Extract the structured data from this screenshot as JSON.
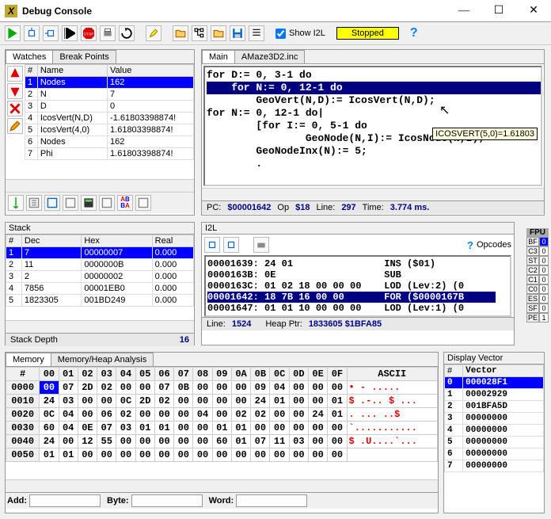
{
  "window": {
    "title": "Debug Console"
  },
  "toolbar": {
    "showI2L": "Show I2L",
    "status": "Stopped"
  },
  "watches": {
    "tabs": [
      "Watches",
      "Break Points"
    ],
    "headers": [
      "#",
      "Name",
      "Value"
    ],
    "rows": [
      {
        "n": "1",
        "name": "Nodes",
        "val": "162"
      },
      {
        "n": "2",
        "name": "N",
        "val": "7"
      },
      {
        "n": "3",
        "name": "D",
        "val": "0"
      },
      {
        "n": "4",
        "name": "IcosVert(N,D)",
        "val": "-1.61803398874!"
      },
      {
        "n": "5",
        "name": "IcosVert(4,0)",
        "val": "1.61803398874!"
      },
      {
        "n": "6",
        "name": "Nodes",
        "val": "162"
      },
      {
        "n": "7",
        "name": "Phi",
        "val": "1.61803398874!"
      }
    ]
  },
  "source": {
    "tabs": [
      "Main",
      "AMaze3D2.inc"
    ],
    "lines": [
      "for D:= 0, 3-1 do",
      "    for N:= 0, 12-1 do",
      "        GeoVert(N,D):= IcosVert(N,D);",
      "",
      "for N:= 0, 12-1 do|",
      "        [for I:= 0, 5-1 do",
      "                GeoNode(N,I):= IcosNode(N,I);",
      "        GeoNodeInx(N):= 5;",
      "        ."
    ],
    "hilite_idx": 1,
    "tooltip": "ICOSVERT(5,0)=1.61803",
    "status": {
      "pc_lbl": "PC:",
      "pc": "$00001642",
      "op_lbl": "Op",
      "op": "$18",
      "line_lbl": "Line:",
      "line": "297",
      "time_lbl": "Time:",
      "time": "3.774 ms."
    }
  },
  "stack": {
    "title": "Stack",
    "headers": [
      "#",
      "Dec",
      "Hex",
      "Real"
    ],
    "rows": [
      {
        "n": "1",
        "d": "7",
        "h": "00000007",
        "r": "0.000"
      },
      {
        "n": "2",
        "d": "11",
        "h": "0000000B",
        "r": "0.000"
      },
      {
        "n": "3",
        "d": "2",
        "h": "00000002",
        "r": "0.000"
      },
      {
        "n": "4",
        "d": "7856",
        "h": "00001EB0",
        "r": "0.000"
      },
      {
        "n": "5",
        "d": "1823305",
        "h": "001BD249",
        "r": "0.000"
      }
    ],
    "depth_lbl": "Stack Depth",
    "depth": "16"
  },
  "i2l": {
    "title": "I2L",
    "opcodes_lbl": "Opcodes",
    "rows": [
      {
        "a": "00001639:",
        "b": "24 01",
        "c": "INS ($01)"
      },
      {
        "a": "0000163B:",
        "b": "0E",
        "c": "SUB"
      },
      {
        "a": "0000163C:",
        "b": "01 02 18 00 00 00",
        "c": "LOD (Lev:2) (0"
      },
      {
        "a": "00001642:",
        "b": "18 7B 16 00 00",
        "c": "FOR ($0000167B"
      },
      {
        "a": "00001647:",
        "b": "01 01 10 00 00 00",
        "c": "LOD (Lev:1) (0"
      }
    ],
    "sel_idx": 3,
    "status": {
      "line_lbl": "Line:",
      "line": "1524",
      "heap_lbl": "Heap Ptr:",
      "heap": "1833605 $1BFA85"
    }
  },
  "fpu": {
    "title": "FPU",
    "flags": [
      {
        "l": "BF",
        "v": "0",
        "b": true
      },
      {
        "l": "C3",
        "v": "0"
      },
      {
        "l": "ST",
        "v": "0"
      },
      {
        "l": "C2",
        "v": "0"
      },
      {
        "l": "C1",
        "v": "0"
      },
      {
        "l": "C0",
        "v": "0"
      },
      {
        "l": "ES",
        "v": "0"
      },
      {
        "l": "SF",
        "v": "0"
      },
      {
        "l": "PE",
        "v": "1"
      }
    ]
  },
  "memory": {
    "tabs": [
      "Memory",
      "Memory/Heap Analysis"
    ],
    "headers": [
      "#",
      "00",
      "01",
      "02",
      "03",
      "04",
      "05",
      "06",
      "07",
      "08",
      "09",
      "0A",
      "0B",
      "0C",
      "0D",
      "0E",
      "0F",
      "ASCII"
    ],
    "rows": [
      {
        "a": "0000",
        "c": [
          "00",
          "07",
          "2D",
          "02",
          "00",
          "00",
          "07",
          "0B",
          "00",
          "00",
          "00",
          "09",
          "04",
          "00",
          "00",
          "00"
        ],
        "t": "• - ....."
      },
      {
        "a": "0010",
        "c": [
          "24",
          "03",
          "00",
          "00",
          "0C",
          "2D",
          "02",
          "00",
          "00",
          "00",
          "00",
          "24",
          "01",
          "00",
          "00",
          "01"
        ],
        "t": "$ .-.. $ ..."
      },
      {
        "a": "0020",
        "c": [
          "0C",
          "04",
          "00",
          "06",
          "02",
          "00",
          "00",
          "00",
          "04",
          "00",
          "02",
          "02",
          "00",
          "00",
          "24",
          "01"
        ],
        "t": ". ... ..$"
      },
      {
        "a": "0030",
        "c": [
          "60",
          "04",
          "0E",
          "07",
          "03",
          "01",
          "01",
          "00",
          "00",
          "01",
          "01",
          "00",
          "00",
          "00",
          "00",
          "00"
        ],
        "t": "`..........."
      },
      {
        "a": "0040",
        "c": [
          "24",
          "00",
          "12",
          "55",
          "00",
          "00",
          "00",
          "00",
          "00",
          "60",
          "01",
          "07",
          "11",
          "03",
          "00",
          "00"
        ],
        "t": "$ .U....`..."
      },
      {
        "a": "0050",
        "c": [
          "01",
          "01",
          "00",
          "00",
          "00",
          "00",
          "00",
          "00",
          "00",
          "00",
          "00",
          "00",
          "00",
          "00",
          "00",
          "00"
        ],
        "t": ""
      }
    ],
    "sel": [
      0,
      0
    ],
    "add_lbl": "Add:",
    "byte_lbl": "Byte:",
    "word_lbl": "Word:"
  },
  "vector": {
    "title": "Display Vector",
    "headers": [
      "#",
      "Vector"
    ],
    "rows": [
      {
        "n": "0",
        "v": "000028F1"
      },
      {
        "n": "1",
        "v": "00002929"
      },
      {
        "n": "2",
        "v": "001BFA5D"
      },
      {
        "n": "3",
        "v": "00000000"
      },
      {
        "n": "4",
        "v": "00000000"
      },
      {
        "n": "5",
        "v": "00000000"
      },
      {
        "n": "6",
        "v": "00000000"
      },
      {
        "n": "7",
        "v": "00000000"
      }
    ]
  }
}
